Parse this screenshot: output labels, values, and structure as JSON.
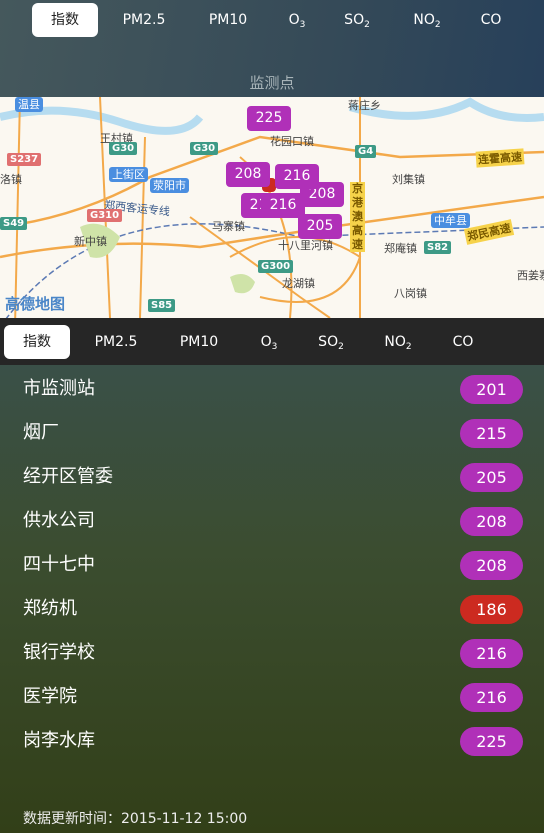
{
  "tabs": [
    {
      "label": "指数",
      "active": true
    },
    {
      "label": "PM2.5"
    },
    {
      "label": "PM10"
    },
    {
      "label": "O",
      "sub": "3"
    },
    {
      "label": "SO",
      "sub": "2"
    },
    {
      "label": "NO",
      "sub": "2"
    },
    {
      "label": "CO"
    }
  ],
  "map": {
    "title": "监测点",
    "logo": "高德地图",
    "labels": [
      "温县",
      "王村镇",
      "蒋庄乡",
      "花园口镇",
      "刘集镇",
      "上街区",
      "荥阳市",
      "郑西客运专线",
      "新中镇",
      "马寨镇",
      "十八里河镇",
      "郑庵镇",
      "中牟县",
      "八岗镇",
      "龙湖镇",
      "西姜寨",
      "连霍高速",
      "郑民高速",
      "京港澳高速",
      "G30",
      "G30",
      "G4",
      "S237",
      "G310",
      "S49",
      "S82",
      "S85",
      "G300",
      "洛镇"
    ],
    "markers": [
      {
        "value": "225",
        "color": "#b030b8"
      },
      {
        "value": "208",
        "color": "#b030b8"
      },
      {
        "value": "216",
        "color": "#b030b8"
      },
      {
        "value": "208",
        "color": "#b030b8"
      },
      {
        "value": "205",
        "color": "#b030b8"
      },
      {
        "value": "216",
        "color": "#b030b8"
      },
      {
        "value": "216",
        "color": "#b030b8"
      },
      {
        "value": "186",
        "color": "#cc2a20"
      }
    ]
  },
  "stations": [
    {
      "name": "市监测站",
      "aqi": "201",
      "color": "#b030b8"
    },
    {
      "name": "烟厂",
      "aqi": "215",
      "color": "#b030b8"
    },
    {
      "name": "经开区管委",
      "aqi": "205",
      "color": "#b030b8"
    },
    {
      "name": "供水公司",
      "aqi": "208",
      "color": "#b030b8"
    },
    {
      "name": "四十七中",
      "aqi": "208",
      "color": "#b030b8"
    },
    {
      "name": "郑纺机",
      "aqi": "186",
      "color": "#cc2a20"
    },
    {
      "name": "银行学校",
      "aqi": "216",
      "color": "#b030b8"
    },
    {
      "name": "医学院",
      "aqi": "216",
      "color": "#b030b8"
    },
    {
      "name": "岗李水库",
      "aqi": "225",
      "color": "#b030b8"
    }
  ],
  "footer": {
    "update_time": "数据更新时间：2015-11-12 15:00"
  }
}
